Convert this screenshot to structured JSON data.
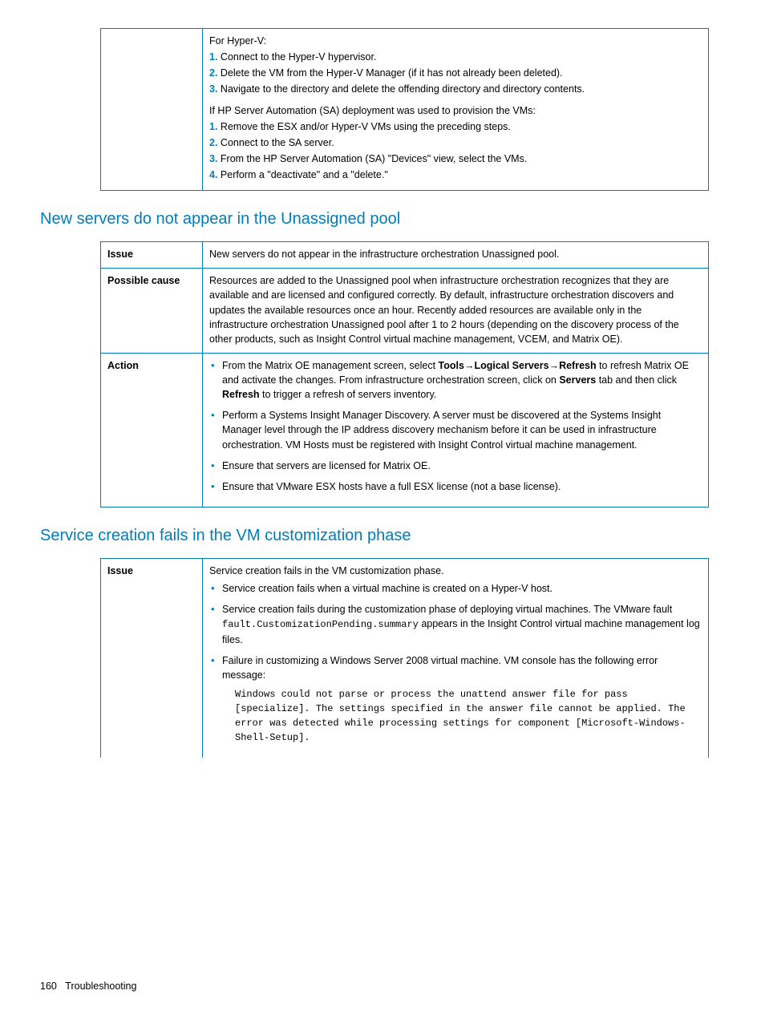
{
  "table1": {
    "hyperv_intro": "For Hyper-V:",
    "hyperv_steps": [
      "Connect to the Hyper-V hypervisor.",
      "Delete the VM from the Hyper-V Manager (if it has not already been deleted).",
      "Navigate to the directory and delete the offending directory and directory contents."
    ],
    "sa_intro": "If HP Server Automation (SA) deployment was used to provision the VMs:",
    "sa_steps": [
      "Remove the ESX and/or Hyper-V VMs using the preceding steps.",
      "Connect to the SA server.",
      "From the HP Server Automation (SA) \"Devices\" view, select the VMs.",
      "Perform a \"deactivate\" and a \"delete.\""
    ]
  },
  "heading2": "New servers do not appear in the Unassigned pool",
  "table2": {
    "issue_label": "Issue",
    "issue_text": "New servers do not appear in the infrastructure orchestration Unassigned pool.",
    "cause_label": "Possible cause",
    "cause_text": "Resources are added to the Unassigned pool when infrastructure orchestration recognizes that they are available and are licensed and configured correctly. By default, infrastructure orchestration discovers and updates the available resources once an hour. Recently added resources are available only in the infrastructure orchestration Unassigned pool after 1 to 2 hours (depending on the discovery process of the other products, such as Insight Control virtual machine management, VCEM, and Matrix OE).",
    "action_label": "Action",
    "action_b1_pre": "From the Matrix OE management screen, select ",
    "action_b1_tools": "Tools",
    "action_b1_ls": "Logical Servers",
    "action_b1_refresh": "Refresh",
    "action_b1_mid": " to refresh Matrix OE and activate the changes. From infrastructure orchestration screen, click on ",
    "action_b1_servers": "Servers",
    "action_b1_mid2": " tab and then click ",
    "action_b1_refresh2": "Refresh",
    "action_b1_post": " to trigger a refresh of servers inventory.",
    "action_b2": "Perform a Systems Insight Manager Discovery. A server must be discovered at the Systems Insight Manager level through the IP address discovery mechanism before it can be used in infrastructure orchestration. VM Hosts must be registered with Insight Control virtual machine management.",
    "action_b3": "Ensure that servers are licensed for Matrix OE.",
    "action_b4": "Ensure that VMware ESX hosts have a full ESX license (not a base license)."
  },
  "heading3": "Service creation fails in the VM customization phase",
  "table3": {
    "issue_label": "Issue",
    "issue_intro": "Service creation fails in the VM customization phase.",
    "b1": "Service creation fails when a virtual machine is created on a Hyper-V host.",
    "b2_pre": "Service creation fails during the customization phase of deploying virtual machines. The VMware fault ",
    "b2_code": "fault.CustomizationPending.summary",
    "b2_post": " appears in the Insight Control virtual machine management log files.",
    "b3": "Failure in customizing a Windows Server 2008 virtual machine. VM console has the following error message:",
    "b3_err": "Windows could not parse or process the unattend answer file for pass [specialize]. The settings specified in the answer file cannot be applied. The error was detected while processing settings for component [Microsoft-Windows-Shell-Setup]."
  },
  "footer": {
    "page": "160",
    "section": "Troubleshooting"
  }
}
